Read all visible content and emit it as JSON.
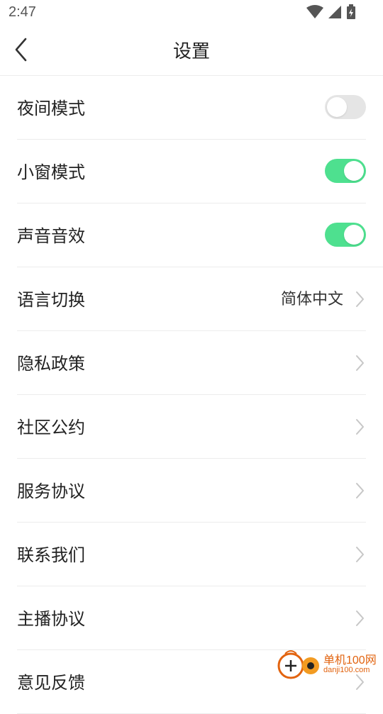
{
  "status_bar": {
    "time": "2:47",
    "icons": [
      "wifi-icon",
      "cell-signal-icon",
      "battery-charging-icon"
    ]
  },
  "header": {
    "back_icon": "chevron-left-icon",
    "title": "设置"
  },
  "settings": {
    "night_mode": {
      "label": "夜间模式",
      "enabled": false
    },
    "mini_window": {
      "label": "小窗模式",
      "enabled": true
    },
    "sound_effects": {
      "label": "声音音效",
      "enabled": true
    },
    "language": {
      "label": "语言切换",
      "value": "简体中文"
    },
    "privacy_policy": {
      "label": "隐私政策"
    },
    "community_rules": {
      "label": "社区公约"
    },
    "service_agreement": {
      "label": "服务协议"
    },
    "contact_us": {
      "label": "联系我们"
    },
    "host_agreement": {
      "label": "主播协议"
    },
    "feedback": {
      "label": "意见反馈"
    }
  },
  "colors": {
    "toggle_on": "#4ee08f",
    "toggle_off": "#e5e5e5",
    "divider": "#ececec",
    "watermark": "#e2630f"
  },
  "watermark": {
    "line1": "单机100网",
    "line2": "danji100.com"
  }
}
